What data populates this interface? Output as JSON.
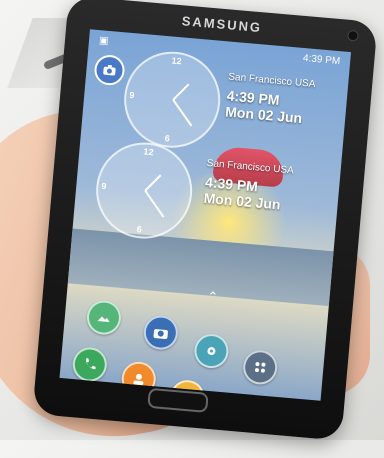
{
  "photo": {
    "brand": "SAMSUNG",
    "status_bar": {
      "left_icon": "notification-icon",
      "time": "4:39 PM"
    },
    "widgets": [
      {
        "location": "San Francisco USA",
        "time": "4:39 PM",
        "date": "Mon 02 Jun"
      },
      {
        "location": "San Francisco USA",
        "time": "4:39 PM",
        "date": "Mon 02 Jun"
      }
    ],
    "clock_numbers": {
      "top": "12",
      "left": "9",
      "bottom": "6"
    },
    "apps": [
      {
        "name": "gallery-icon",
        "color": "#56b67a"
      },
      {
        "name": "camera-icon",
        "color": "#3a6fb6"
      },
      {
        "name": "settings-icon",
        "color": "#4aa3b6"
      },
      {
        "name": "phone-icon",
        "color": "#3ca85e"
      },
      {
        "name": "contacts-icon",
        "color": "#f08a2a"
      },
      {
        "name": "messages-icon",
        "color": "#f2b53b"
      },
      {
        "name": "apps-icon",
        "color": "#5b6f87"
      }
    ],
    "accent": "#4a7ac7"
  }
}
